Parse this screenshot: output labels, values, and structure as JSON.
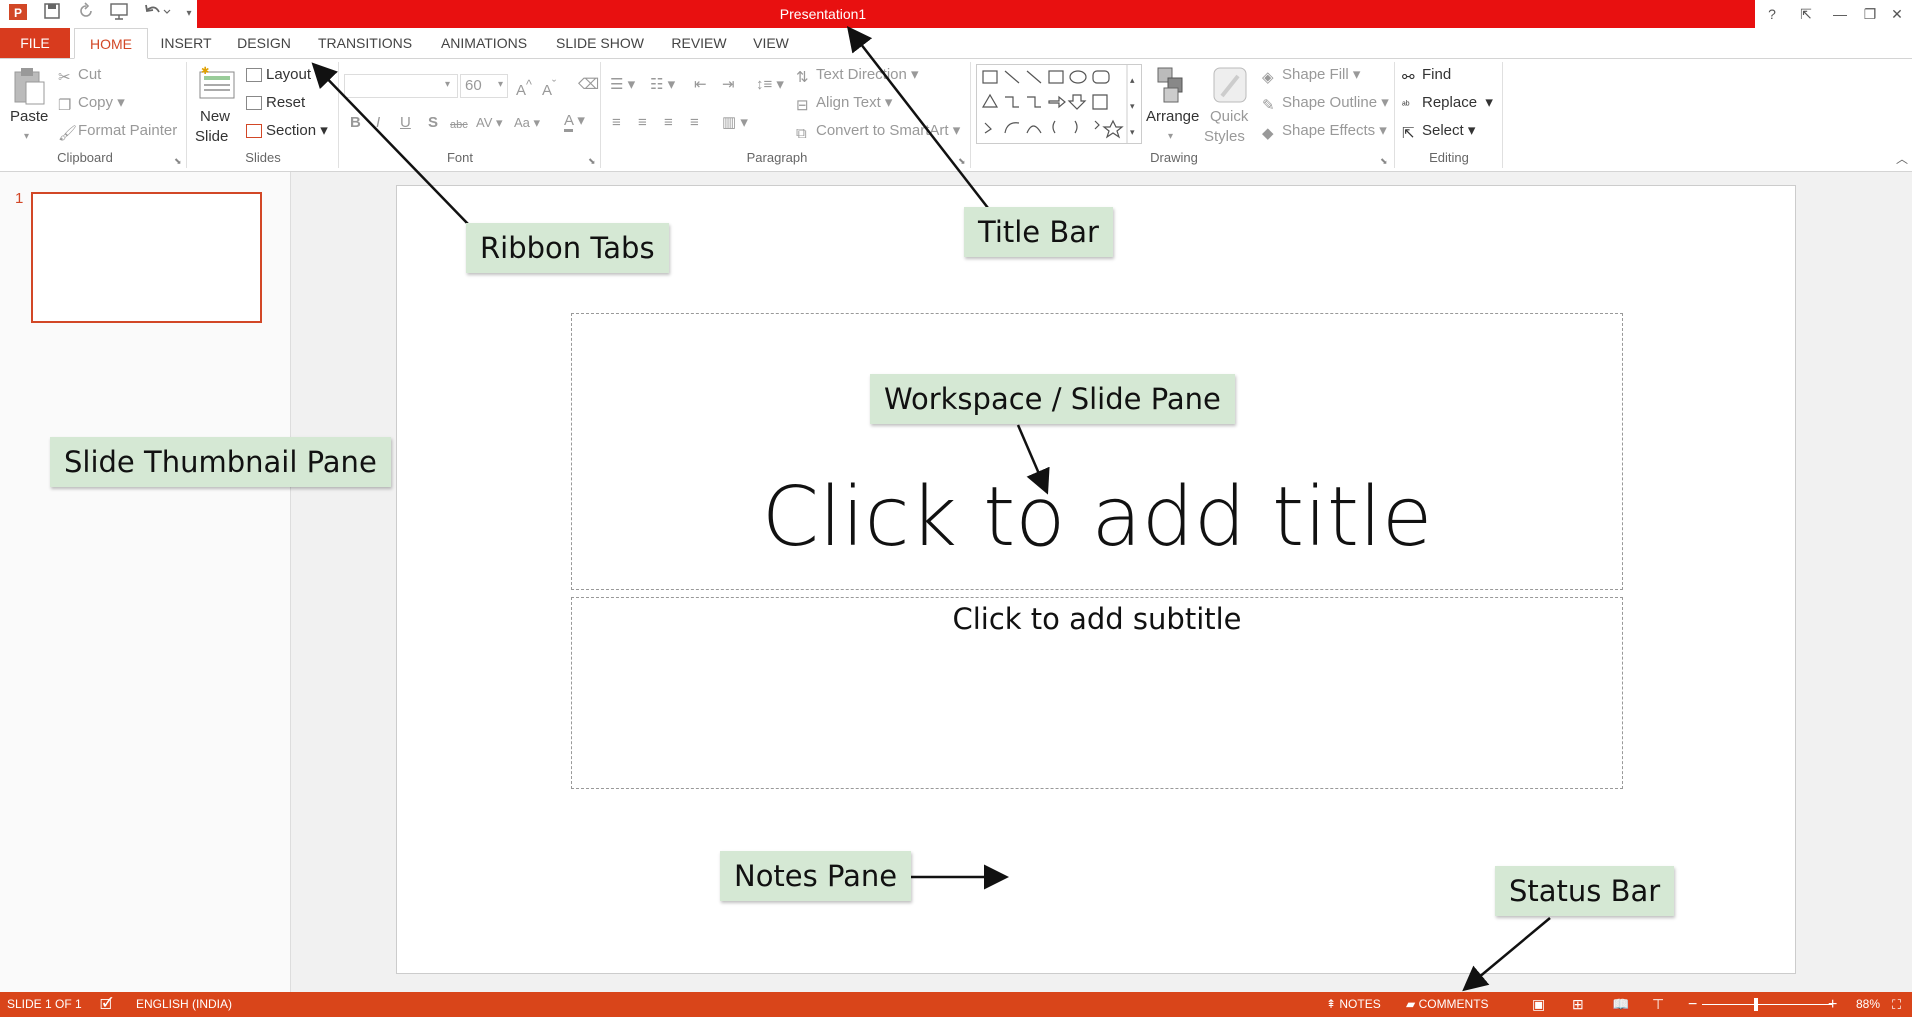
{
  "titlebar": {
    "doc_title": "Presentation1",
    "help": "?",
    "ribbon_display": "⇱",
    "minimize": "—",
    "restore": "❐",
    "close": "✕",
    "qat_icons": [
      "powerpoint-logo-icon",
      "save-icon",
      "redo-icon",
      "start-from-beginning-icon",
      "undo-icon",
      "customize-qat-icon"
    ]
  },
  "tabs": [
    "FILE",
    "HOME",
    "INSERT",
    "DESIGN",
    "TRANSITIONS",
    "ANIMATIONS",
    "SLIDE SHOW",
    "REVIEW",
    "VIEW"
  ],
  "ribbon": {
    "clipboard": {
      "paste": "Paste",
      "cut": "Cut",
      "copy": "Copy",
      "format_painter": "Format Painter",
      "label": "Clipboard"
    },
    "slides": {
      "new_slide_1": "New",
      "new_slide_2": "Slide",
      "layout": "Layout",
      "reset": "Reset",
      "section": "Section",
      "label": "Slides"
    },
    "font": {
      "font_size": "60",
      "label": "Font"
    },
    "paragraph": {
      "text_direction": "Text Direction",
      "align_text": "Align Text",
      "convert_smartart": "Convert to SmartArt",
      "label": "Paragraph"
    },
    "drawing": {
      "arrange": "Arrange",
      "quick_styles_1": "Quick",
      "quick_styles_2": "Styles",
      "shape_fill": "Shape Fill",
      "shape_outline": "Shape Outline",
      "shape_effects": "Shape Effects",
      "label": "Drawing"
    },
    "editing": {
      "find": "Find",
      "replace": "Replace",
      "select": "Select",
      "label": "Editing"
    }
  },
  "thumbnails": {
    "slide_number": "1"
  },
  "slide": {
    "title_placeholder": "Click to add title",
    "subtitle_placeholder": "Click to add subtitle"
  },
  "callouts": {
    "ribbon_tabs": "Ribbon Tabs",
    "title_bar": "Title Bar",
    "workspace": "Workspace / Slide Pane",
    "thumbnail_pane": "Slide Thumbnail Pane",
    "notes_pane": "Notes Pane",
    "status_bar": "Status Bar"
  },
  "statusbar": {
    "slide_counter": "SLIDE 1 OF 1",
    "language": "ENGLISH (INDIA)",
    "notes": "NOTES",
    "comments": "COMMENTS",
    "zoom_minus": "−",
    "zoom_plus": "+",
    "zoom": "88%"
  }
}
